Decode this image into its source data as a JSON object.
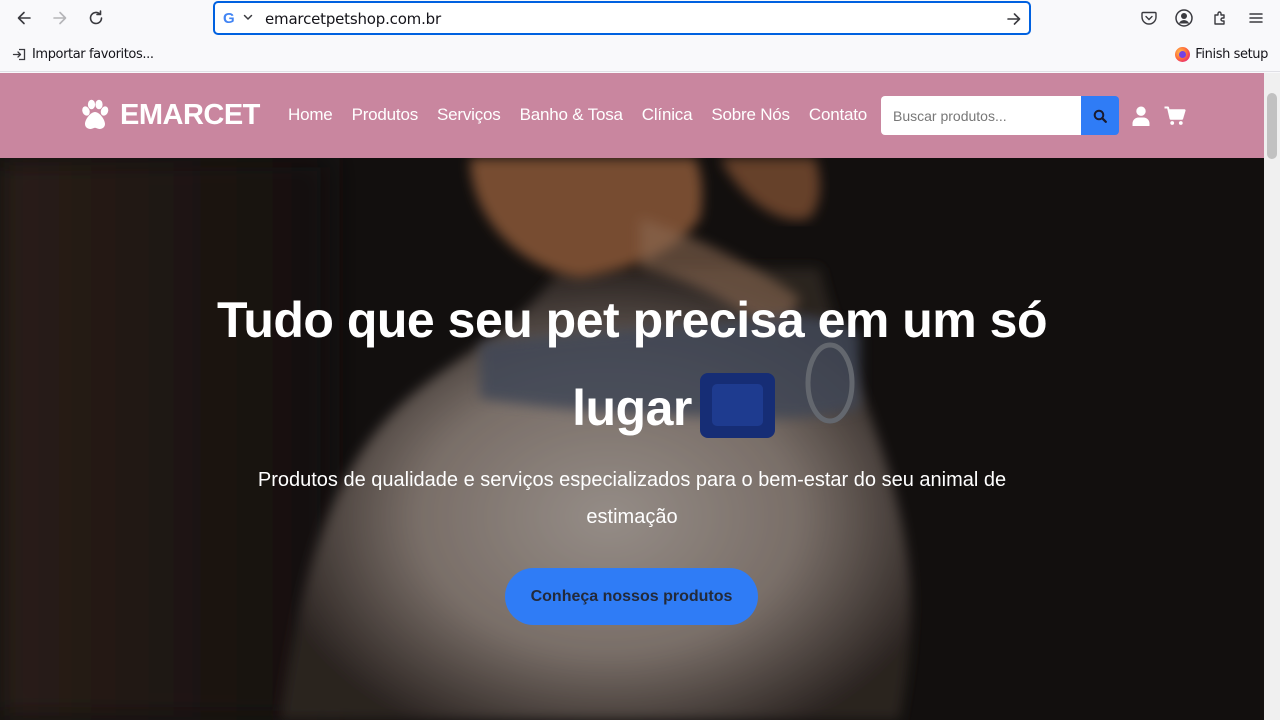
{
  "browser": {
    "url": "emarcetpetshop.com.br",
    "bookmarks": {
      "import_label": "Importar favoritos...",
      "finish_label": "Finish setup"
    }
  },
  "site": {
    "logo_text": "EMARCET",
    "nav": [
      "Home",
      "Produtos",
      "Serviços",
      "Banho & Tosa",
      "Clínica",
      "Sobre Nós",
      "Contato"
    ],
    "search_placeholder": "Buscar produtos..."
  },
  "hero": {
    "title": "Tudo que seu pet precisa em um só lugar",
    "subtitle": "Produtos de qualidade e serviços especializados para o bem-estar do seu animal de estimação",
    "cta_label": "Conheça nossos produtos"
  },
  "colors": {
    "header_bg": "#c9869f",
    "accent_blue": "#2f7cf6",
    "url_focus": "#0061e0"
  }
}
